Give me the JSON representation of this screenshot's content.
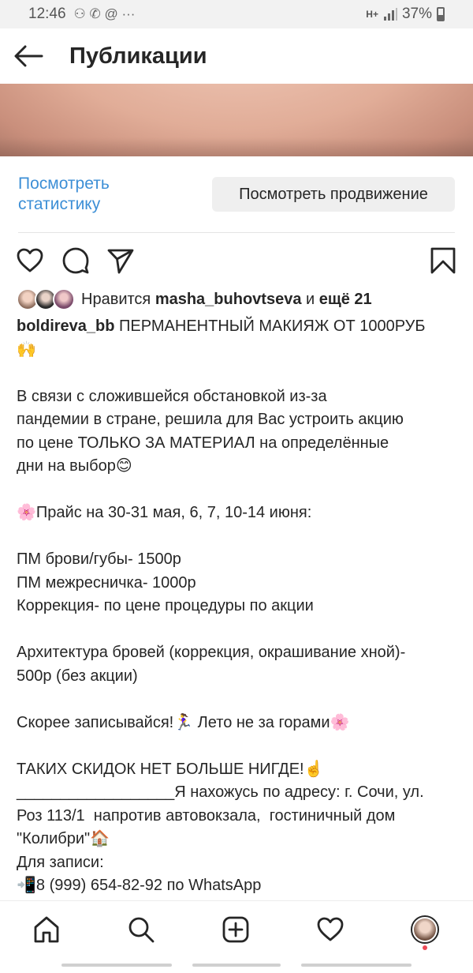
{
  "status_bar": {
    "time": "12:46",
    "notification_glyphs": "⚇ ✆ @  ···",
    "network": "H+",
    "battery": "37%"
  },
  "header": {
    "title": "Публикации",
    "back_icon": "arrow-left-icon"
  },
  "insights": {
    "stats_link": "Посмотреть статистику",
    "promo_button": "Посмотреть продвижение"
  },
  "actions": {
    "icons": [
      "heart-icon",
      "comment-icon",
      "share-icon",
      "bookmark-icon"
    ]
  },
  "likes": {
    "prefix": "Нравится ",
    "user": "masha_buhovtseva",
    "middle": " и ",
    "others": "ещё 21"
  },
  "caption": {
    "username": "boldireva_bb",
    "text": " ПЕРМАНЕНТНЫЙ МАКИЯЖ ОТ 1000РУБ\n🙌\n\nВ связи с сложившейся обстановкой из-за\nпандемии в стране, решила для Вас устроить акцию\nпо цене ТОЛЬКО ЗА МАТЕРИАЛ на определённые\nдни на выбор😊\n\n🌸Прайс на 30-31 мая, 6, 7, 10-14 июня:\n\nПМ брови/губы- 1500р\nПМ межресничка- 1000р\nКоррекция- по цене процедуры по акции\n\nАрхитектура бровей (коррекция, окрашивание хной)-\n500р (без акции)\n\nСкорее записывайся!🏃‍♀️ Лето не за горами🌸\n\nТАКИХ СКИДОК НЕТ БОЛЬШЕ НИГДЕ!☝️\n__________________Я нахожусь по адресу: г. Сочи, ул.\nРоз 113/1  напротив автовокзала,  гостиничный дом\n\"Колибри\"🏠\nДля записи:\n📲8 (999) 654-82-92 по WhatsApp"
  },
  "bottom_nav": {
    "items": [
      "home-icon",
      "search-icon",
      "add-post-icon",
      "activity-heart-icon",
      "profile-avatar"
    ]
  }
}
